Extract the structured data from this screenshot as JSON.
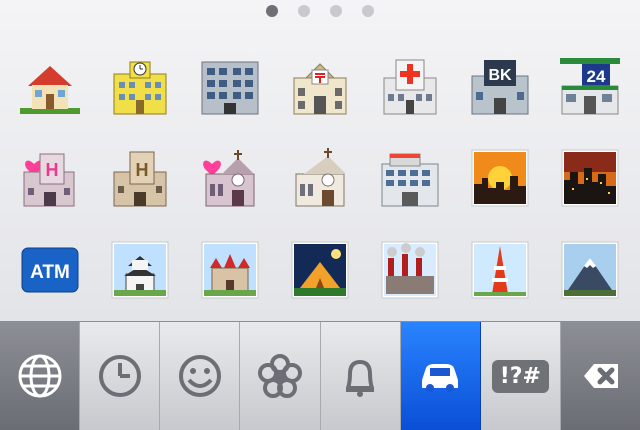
{
  "keyboard": {
    "pagination": {
      "count": 4,
      "active_index": 0
    },
    "emojis": [
      {
        "name": "house",
        "text": ""
      },
      {
        "name": "office-building-clock",
        "text": ""
      },
      {
        "name": "office-building",
        "text": ""
      },
      {
        "name": "post-office",
        "text": ""
      },
      {
        "name": "hospital",
        "text": ""
      },
      {
        "name": "bank",
        "text": "BK"
      },
      {
        "name": "convenience-store",
        "text": "24"
      },
      {
        "name": "love-hotel",
        "text": "H"
      },
      {
        "name": "hotel",
        "text": "H"
      },
      {
        "name": "wedding-chapel",
        "text": ""
      },
      {
        "name": "church",
        "text": ""
      },
      {
        "name": "department-store",
        "text": ""
      },
      {
        "name": "sunset-city",
        "text": ""
      },
      {
        "name": "dusk-city",
        "text": ""
      },
      {
        "name": "atm",
        "text": "ATM"
      },
      {
        "name": "japanese-castle",
        "text": ""
      },
      {
        "name": "european-castle",
        "text": ""
      },
      {
        "name": "tent-night",
        "text": ""
      },
      {
        "name": "factory",
        "text": ""
      },
      {
        "name": "tokyo-tower",
        "text": ""
      },
      {
        "name": "mount-fuji",
        "text": ""
      }
    ],
    "tabs": [
      {
        "name": "globe-icon",
        "label": ""
      },
      {
        "name": "clock-icon",
        "label": ""
      },
      {
        "name": "smiley-icon",
        "label": ""
      },
      {
        "name": "flower-icon",
        "label": ""
      },
      {
        "name": "bell-icon",
        "label": ""
      },
      {
        "name": "car-icon",
        "label": "",
        "active": true
      },
      {
        "name": "symbols-icon",
        "label": "!?#"
      },
      {
        "name": "delete-icon",
        "label": ""
      }
    ],
    "colors": {
      "active_tab": "#1565f2",
      "dark_tab": "#7b7e84",
      "dot_active": "#6f7075",
      "dot_inactive": "#c9cacd"
    }
  }
}
